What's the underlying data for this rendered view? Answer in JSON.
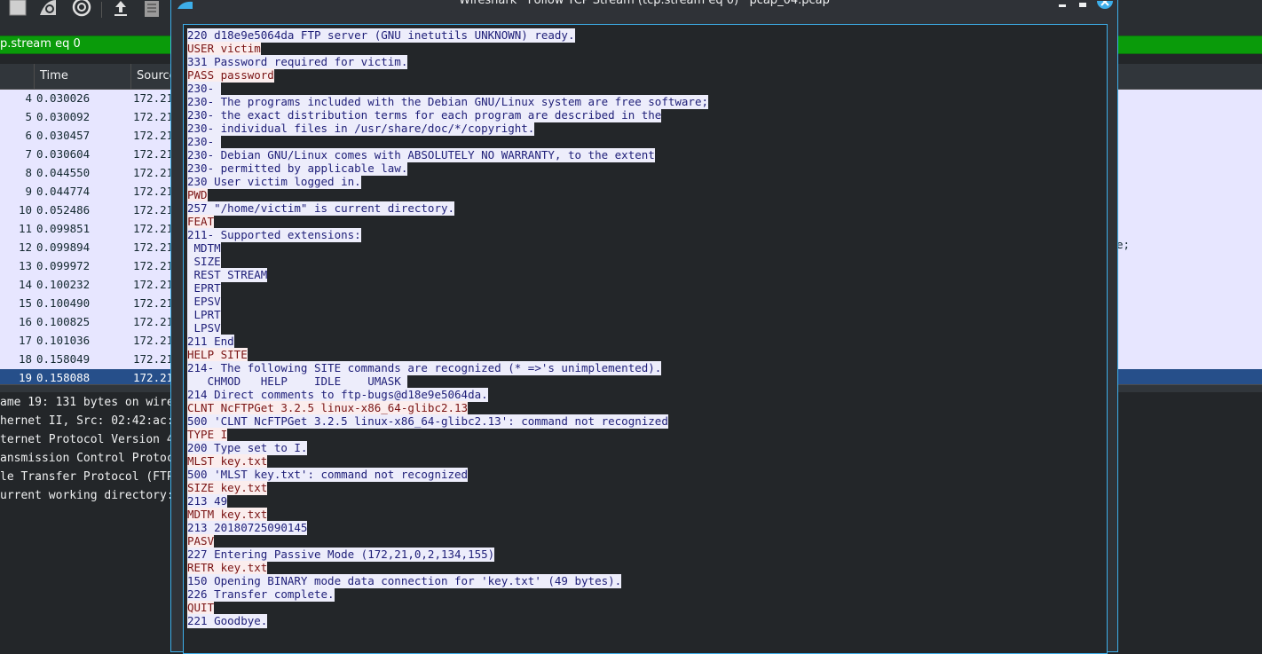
{
  "main_window": {
    "filter_text": "p.stream eq 0",
    "columns": {
      "no": "",
      "time": "Time",
      "source": "Source"
    },
    "packets": [
      {
        "no": "4",
        "time": "0.030026",
        "src": "172.21"
      },
      {
        "no": "5",
        "time": "0.030092",
        "src": "172.21"
      },
      {
        "no": "6",
        "time": "0.030457",
        "src": "172.21"
      },
      {
        "no": "7",
        "time": "0.030604",
        "src": "172.21"
      },
      {
        "no": "8",
        "time": "0.044550",
        "src": "172.21"
      },
      {
        "no": "9",
        "time": "0.044774",
        "src": "172.21"
      },
      {
        "no": "10",
        "time": "0.052486",
        "src": "172.21"
      },
      {
        "no": "11",
        "time": "0.099851",
        "src": "172.21"
      },
      {
        "no": "12",
        "time": "0.099894",
        "src": "172.21"
      },
      {
        "no": "13",
        "time": "0.099972",
        "src": "172.21"
      },
      {
        "no": "14",
        "time": "0.100232",
        "src": "172.21"
      },
      {
        "no": "15",
        "time": "0.100490",
        "src": "172.21"
      },
      {
        "no": "16",
        "time": "0.100825",
        "src": "172.21"
      },
      {
        "no": "17",
        "time": "0.101036",
        "src": "172.21"
      },
      {
        "no": "18",
        "time": "0.158049",
        "src": "172.21"
      },
      {
        "no": "19",
        "time": "0.158088",
        "src": "172.21"
      }
    ],
    "info_tail": "e;",
    "details": [
      "ame 19: 131 bytes on wire",
      "hernet II, Src: 02:42:ac:",
      "ternet Protocol Version 4",
      "ansmission Control Protoc",
      "le Transfer Protocol (FTP",
      "urrent working directory:"
    ]
  },
  "dialog": {
    "title": "Wireshark · Follow TCP Stream (tcp.stream eq 0) · pcap_04.pcap",
    "stream": [
      {
        "dir": "server",
        "text": "220 d18e9e5064da FTP server (GNU inetutils UNKNOWN) ready."
      },
      {
        "dir": "client",
        "text": "USER victim"
      },
      {
        "dir": "server",
        "text": "331 Password required for victim."
      },
      {
        "dir": "client",
        "text": "PASS password"
      },
      {
        "dir": "server",
        "text": "230- "
      },
      {
        "dir": "server",
        "text": "230- The programs included with the Debian GNU/Linux system are free software;"
      },
      {
        "dir": "server",
        "text": "230- the exact distribution terms for each program are described in the"
      },
      {
        "dir": "server",
        "text": "230- individual files in /usr/share/doc/*/copyright."
      },
      {
        "dir": "server",
        "text": "230- "
      },
      {
        "dir": "server",
        "text": "230- Debian GNU/Linux comes with ABSOLUTELY NO WARRANTY, to the extent"
      },
      {
        "dir": "server",
        "text": "230- permitted by applicable law."
      },
      {
        "dir": "server",
        "text": "230 User victim logged in."
      },
      {
        "dir": "client",
        "text": "PWD"
      },
      {
        "dir": "server",
        "text": "257 \"/home/victim\" is current directory."
      },
      {
        "dir": "client",
        "text": "FEAT"
      },
      {
        "dir": "server",
        "text": "211- Supported extensions:"
      },
      {
        "dir": "server",
        "text": " MDTM"
      },
      {
        "dir": "server",
        "text": " SIZE"
      },
      {
        "dir": "server",
        "text": " REST STREAM"
      },
      {
        "dir": "server",
        "text": " EPRT"
      },
      {
        "dir": "server",
        "text": " EPSV"
      },
      {
        "dir": "server",
        "text": " LPRT"
      },
      {
        "dir": "server",
        "text": " LPSV"
      },
      {
        "dir": "server",
        "text": "211 End"
      },
      {
        "dir": "client",
        "text": "HELP SITE"
      },
      {
        "dir": "server",
        "text": "214- The following SITE commands are recognized (* =>'s unimplemented)."
      },
      {
        "dir": "server",
        "text": "   CHMOD   HELP    IDLE    UMASK "
      },
      {
        "dir": "server",
        "text": "214 Direct comments to ftp-bugs@d18e9e5064da."
      },
      {
        "dir": "client",
        "text": "CLNT NcFTPGet 3.2.5 linux-x86_64-glibc2.13"
      },
      {
        "dir": "server",
        "text": "500 'CLNT NcFTPGet 3.2.5 linux-x86_64-glibc2.13': command not recognized"
      },
      {
        "dir": "client",
        "text": "TYPE I"
      },
      {
        "dir": "server",
        "text": "200 Type set to I."
      },
      {
        "dir": "client",
        "text": "MLST key.txt"
      },
      {
        "dir": "server",
        "text": "500 'MLST key.txt': command not recognized"
      },
      {
        "dir": "client",
        "text": "SIZE key.txt"
      },
      {
        "dir": "server",
        "text": "213 49"
      },
      {
        "dir": "client",
        "text": "MDTM key.txt"
      },
      {
        "dir": "server",
        "text": "213 20180725090145"
      },
      {
        "dir": "client",
        "text": "PASV"
      },
      {
        "dir": "server",
        "text": "227 Entering Passive Mode (172,21,0,2,134,155)"
      },
      {
        "dir": "client",
        "text": "RETR key.txt"
      },
      {
        "dir": "server",
        "text": "150 Opening BINARY mode data connection for 'key.txt' (49 bytes)."
      },
      {
        "dir": "server",
        "text": "226 Transfer complete."
      },
      {
        "dir": "client",
        "text": "QUIT"
      },
      {
        "dir": "server",
        "text": "221 Goodbye."
      }
    ]
  },
  "colors": {
    "accent": "#3daee9",
    "filter_ok": "#0a9b0a",
    "selected_row": "#264f8a",
    "server_bg": "#ededfb",
    "server_fg": "#1e1e78",
    "client_bg": "#fbeded",
    "client_fg": "#7a1414"
  }
}
